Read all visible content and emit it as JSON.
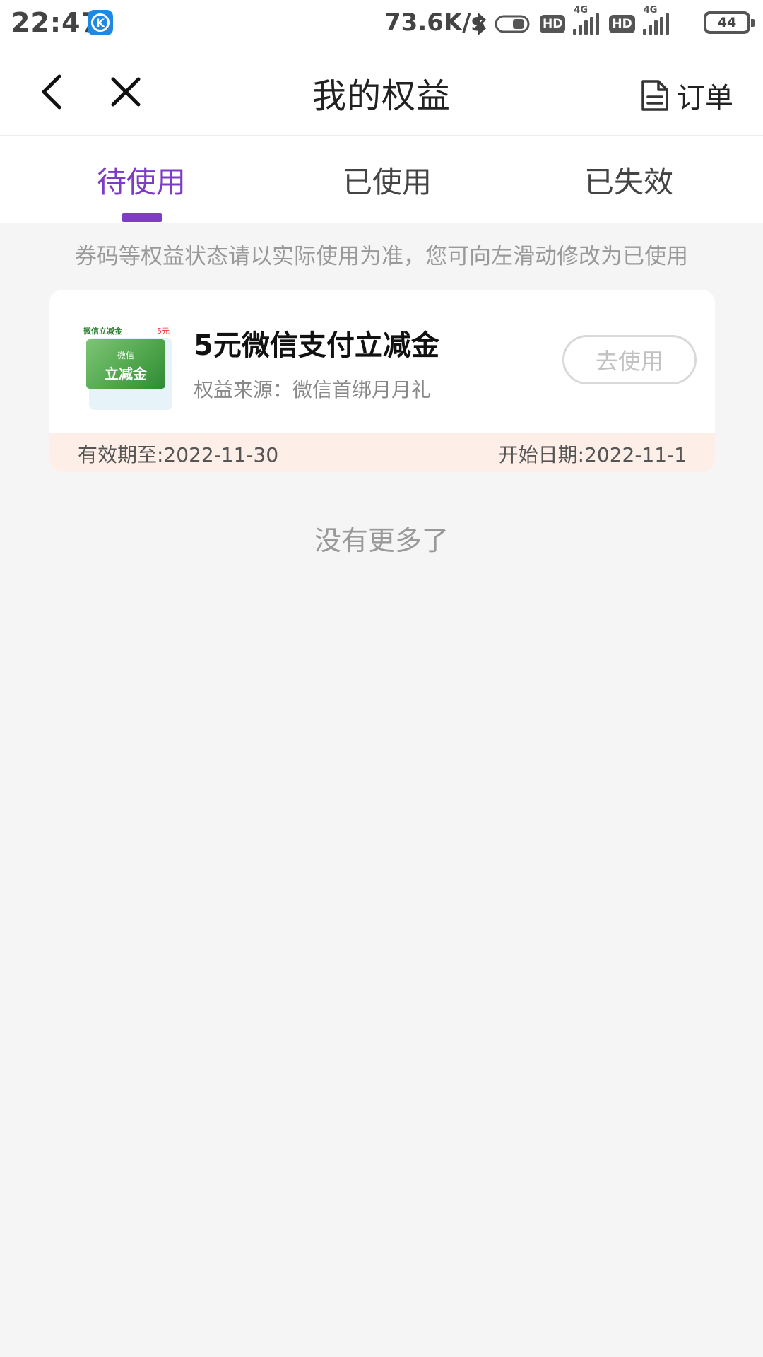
{
  "status_bar": {
    "time": "22:47",
    "app_icon_letter": "K",
    "net_speed": "73.6K/s",
    "icons": [
      "bluetooth-icon",
      "toggle-icon",
      "hd-icon",
      "signal-4g-icon",
      "hd-icon",
      "signal-4g-icon"
    ],
    "hd_label": "HD",
    "network_label": "4G",
    "battery": "44"
  },
  "nav": {
    "title": "我的权益",
    "order_label": "订单"
  },
  "tabs": [
    {
      "label": "待使用",
      "active": true
    },
    {
      "label": "已使用",
      "active": false
    },
    {
      "label": "已失效",
      "active": false
    }
  ],
  "notice": "券码等权益状态请以实际使用为准，您可向左滑动修改为已使用",
  "coupon": {
    "thumb_header": "微信立减金",
    "thumb_price": "5元",
    "thumb_sub": "微信",
    "thumb_main": "立减金",
    "title": "5元微信支付立减金",
    "source": "权益来源：微信首绑月月礼",
    "use_button": "去使用",
    "expire": "有效期至:2022-11-30",
    "start": "开始日期:2022-11-1"
  },
  "no_more": "没有更多了",
  "colors": {
    "accent": "#7e3bc6",
    "background": "#f5f5f5",
    "footer_bg": "#fdeee8"
  }
}
